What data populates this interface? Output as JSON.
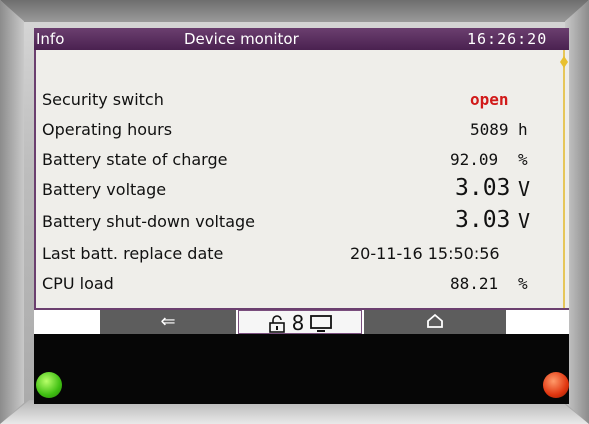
{
  "header": {
    "info": "Info",
    "title": "Device monitor",
    "time": "16:26:20"
  },
  "rows": [
    {
      "label": "Security switch",
      "value": "open",
      "unit": ""
    },
    {
      "label": "Operating hours",
      "value": "5089",
      "unit": "h"
    },
    {
      "label": "Battery state of charge",
      "value": "92.09",
      "unit": "%"
    },
    {
      "label": "Battery voltage",
      "value": "3.03",
      "unit": "V"
    },
    {
      "label": "Battery shut-down voltage",
      "value": "3.03",
      "unit": "V"
    },
    {
      "label": "Last batt. replace date",
      "value": "20-11-16 15:50:56",
      "unit": ""
    },
    {
      "label": "CPU load",
      "value": "88.21",
      "unit": "%"
    }
  ],
  "nav": {
    "back": "⇐",
    "lock": "🔓",
    "user": "8",
    "monitor": "🖵",
    "home": "⌂"
  },
  "colors": {
    "header": "#5a2d60",
    "open_status": "#d11a1a",
    "led_left": "#3fbf12",
    "led_right": "#e0350f"
  },
  "icons": {
    "back": "back-arrow-icon",
    "lock": "unlock-icon",
    "user": "user-icon",
    "monitor": "monitor-icon",
    "home": "home-icon",
    "scroll": "scroll-indicator-icon"
  }
}
